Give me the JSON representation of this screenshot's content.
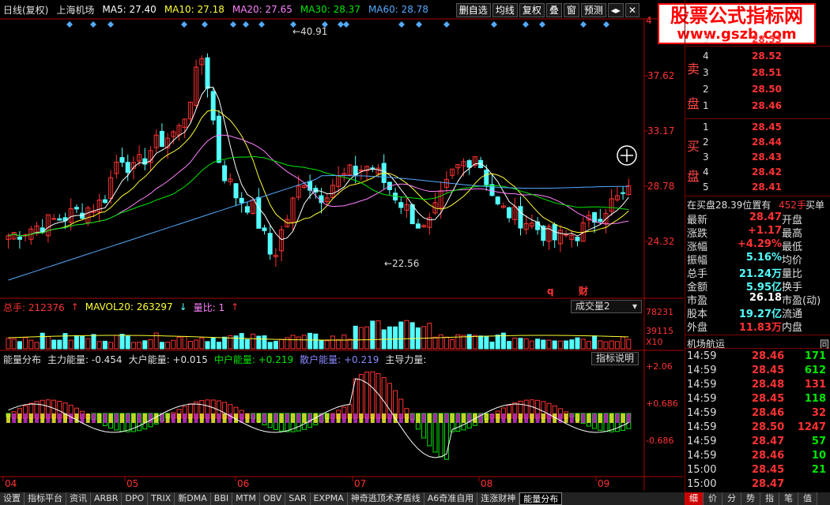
{
  "header": {
    "period": "日线(复权)",
    "stock": "上海机场",
    "ma": [
      {
        "label": "MA5: 27.40",
        "color": "#ffffff"
      },
      {
        "label": "MA10: 27.18",
        "color": "#ffff33"
      },
      {
        "label": "MA20: 27.65",
        "color": "#ff80ff"
      },
      {
        "label": "MA30: 28.37",
        "color": "#00e600"
      },
      {
        "label": "MA60: 28.78",
        "color": "#54aaff"
      }
    ],
    "buttons": [
      "删自选",
      "均线",
      "复权",
      "叠",
      "窗",
      "预测"
    ],
    "nav_icons": [
      "arrow-left-right-icon",
      "close-icon"
    ]
  },
  "logo": {
    "line1": "股票公式指标网",
    "line2": "www.gszb.com"
  },
  "kline": {
    "price_axis": [
      "37.62",
      "33.17",
      "28.78",
      "24.32"
    ],
    "top_label": "4",
    "high_mark": "40.91",
    "low_mark": "22.56",
    "markers": [
      {
        "text": "q",
        "color": "#ff3232"
      },
      {
        "text": "财",
        "color": "#ff3232"
      }
    ],
    "x_labels": [
      "04",
      "05",
      "06",
      "07",
      "08",
      "09"
    ]
  },
  "volume": {
    "total": "总手: 212376",
    "mavol": "MAVOL20: 263297",
    "ratio": "量比: 1",
    "selector": "成交量2",
    "axis": [
      "78231",
      "39115",
      "X10"
    ]
  },
  "energy": {
    "name": "能量分布",
    "main": "主力能量: -0.454",
    "big": "大户能量: +0.015",
    "mid": "中户能量: +0.219",
    "retail": "散户能量: +0.219",
    "lead": "主导力量:",
    "help": "指标说明",
    "axis": [
      "+2.06",
      "+0.686",
      "-0.686"
    ]
  },
  "orderbook": {
    "sell_label": [
      "卖",
      "盘"
    ],
    "buy_label": [
      "买",
      "盘"
    ],
    "sell": [
      {
        "n": "5",
        "p": "28.53"
      },
      {
        "n": "4",
        "p": "28.52"
      },
      {
        "n": "3",
        "p": "28.51"
      },
      {
        "n": "2",
        "p": "28.50"
      },
      {
        "n": "1",
        "p": "28.46"
      }
    ],
    "buy": [
      {
        "n": "1",
        "p": "28.45"
      },
      {
        "n": "2",
        "p": "28.44"
      },
      {
        "n": "3",
        "p": "28.43"
      },
      {
        "n": "4",
        "p": "28.42"
      },
      {
        "n": "5",
        "p": "28.41"
      }
    ],
    "onbuy": "在买盘28.39位置有",
    "onbuy_vol": "452手",
    "onbuy_btn": "买单"
  },
  "quote": [
    {
      "k1": "最新",
      "v1": "28.47",
      "c": "#ff3232",
      "k2": "开盘"
    },
    {
      "k1": "涨跌",
      "v1": "+1.17",
      "c": "#ff3232",
      "k2": "最高"
    },
    {
      "k1": "涨幅",
      "v1": "+4.29%",
      "c": "#ff3232",
      "k2": "最低"
    },
    {
      "k1": "振幅",
      "v1": "5.16%",
      "c": "#54ffff",
      "k2": "均价"
    },
    {
      "k1": "总手",
      "v1": "21.24万",
      "c": "#54ffff",
      "k2": "量比"
    },
    {
      "k1": "金额",
      "v1": "5.95亿",
      "c": "#54ffff",
      "k2": "换手"
    },
    {
      "k1": "市盈",
      "v1": "26.18",
      "c": "#ffffff",
      "k2": "市盈(动)"
    },
    {
      "k1": "股本",
      "v1": "19.27亿",
      "c": "#54ffff",
      "k2": "流通"
    },
    {
      "k1": "外盘",
      "v1": "11.83万",
      "c": "#ff3232",
      "k2": "内盘"
    }
  ],
  "ticks_title": "机场航运",
  "ticks_side": "同",
  "ticks": [
    {
      "t": "14:59",
      "p": "28.46",
      "v": "171",
      "c": "#00e600"
    },
    {
      "t": "14:59",
      "p": "28.45",
      "v": "612",
      "c": "#00e600"
    },
    {
      "t": "14:59",
      "p": "28.48",
      "v": "131",
      "c": "#ff3232"
    },
    {
      "t": "14:59",
      "p": "28.45",
      "v": "118",
      "c": "#00e600"
    },
    {
      "t": "14:59",
      "p": "28.46",
      "v": "32",
      "c": "#ff3232"
    },
    {
      "t": "14:59",
      "p": "28.50",
      "v": "1247",
      "c": "#ff3232"
    },
    {
      "t": "14:59",
      "p": "28.47",
      "v": "57",
      "c": "#00e600"
    },
    {
      "t": "14:59",
      "p": "28.46",
      "v": "10",
      "c": "#00e600"
    },
    {
      "t": "15:00",
      "p": "28.45",
      "v": "21",
      "c": "#00e600"
    },
    {
      "t": "15:00",
      "p": "28.47",
      "v": "",
      "c": "#ff3232"
    }
  ],
  "tabs": [
    "设置",
    "指标平台",
    "资讯",
    "ARBR",
    "DPO",
    "TRIX",
    "新DMA",
    "BBI",
    "MTM",
    "OBV",
    "SAR",
    "EXPMA",
    "神奇逃顶术矛盾线",
    "A6奇准自用",
    "连涨财神",
    "能量分布"
  ],
  "active_tab": 15,
  "right_tabs": [
    "细",
    "价",
    "分",
    "势",
    "指",
    "笔",
    "值"
  ],
  "right_active": 0
}
